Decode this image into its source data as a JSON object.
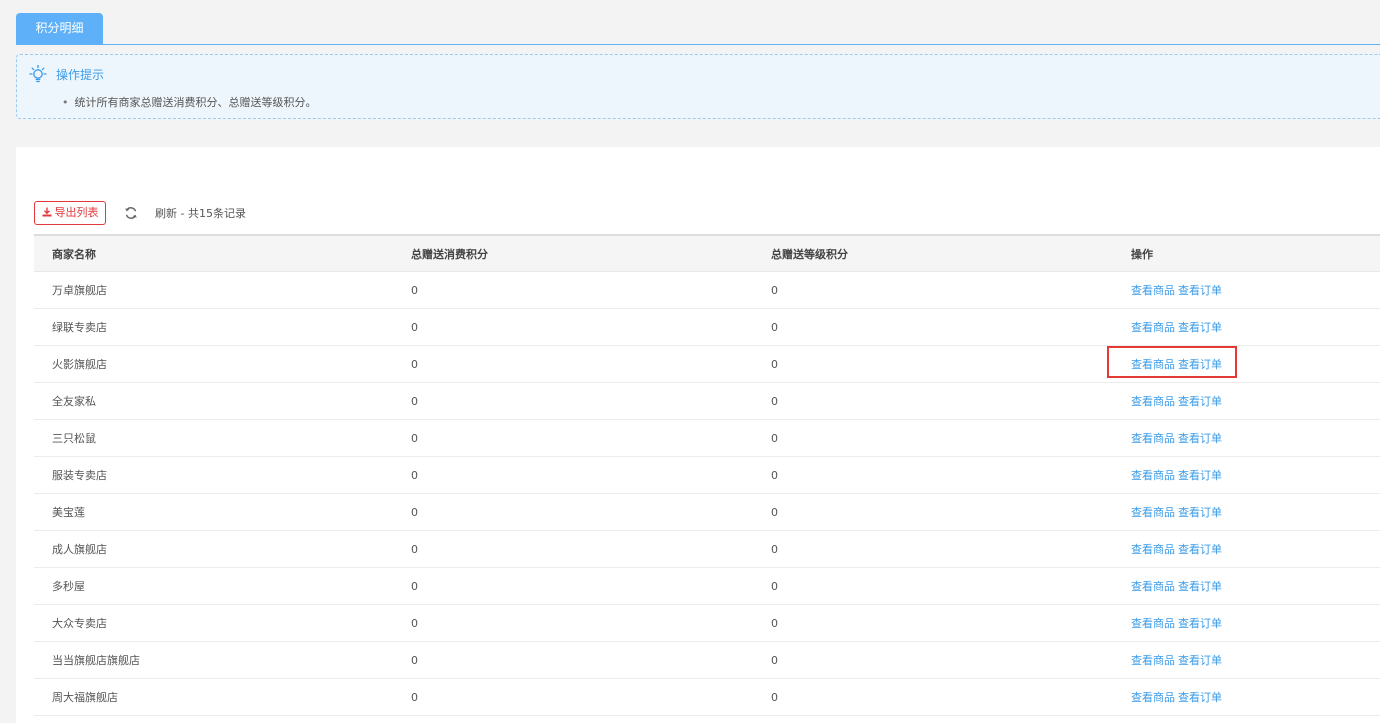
{
  "tab": {
    "label": "积分明细"
  },
  "tips": {
    "title": "操作提示",
    "lines": [
      "统计所有商家总赠送消费积分、总赠送等级积分。"
    ]
  },
  "toolbar": {
    "export_label": "导出列表",
    "refresh_text": "刷新 - 共15条记录"
  },
  "table": {
    "headers": [
      "商家名称",
      "总赠送消费积分",
      "总赠送等级积分",
      "操作"
    ],
    "action_labels": {
      "view_goods": "查看商品",
      "view_orders": "查看订单"
    },
    "rows": [
      {
        "name": "万卓旗舰店",
        "consume_points": "0",
        "level_points": "0"
      },
      {
        "name": "绿联专卖店",
        "consume_points": "0",
        "level_points": "0"
      },
      {
        "name": "火影旗舰店",
        "consume_points": "0",
        "level_points": "0"
      },
      {
        "name": "全友家私",
        "consume_points": "0",
        "level_points": "0"
      },
      {
        "name": "三只松鼠",
        "consume_points": "0",
        "level_points": "0"
      },
      {
        "name": "服装专卖店",
        "consume_points": "0",
        "level_points": "0"
      },
      {
        "name": "美宝莲",
        "consume_points": "0",
        "level_points": "0"
      },
      {
        "name": "成人旗舰店",
        "consume_points": "0",
        "level_points": "0"
      },
      {
        "name": "多秒屋",
        "consume_points": "0",
        "level_points": "0"
      },
      {
        "name": "大众专卖店",
        "consume_points": "0",
        "level_points": "0"
      },
      {
        "name": "当当旗舰店旗舰店",
        "consume_points": "0",
        "level_points": "0"
      },
      {
        "name": "周大福旗舰店",
        "consume_points": "0",
        "level_points": "0"
      }
    ]
  },
  "colors": {
    "accent": "#5eb1f8",
    "link": "#3a9be8",
    "danger": "#e4393c",
    "highlight_box": "#e53935"
  }
}
